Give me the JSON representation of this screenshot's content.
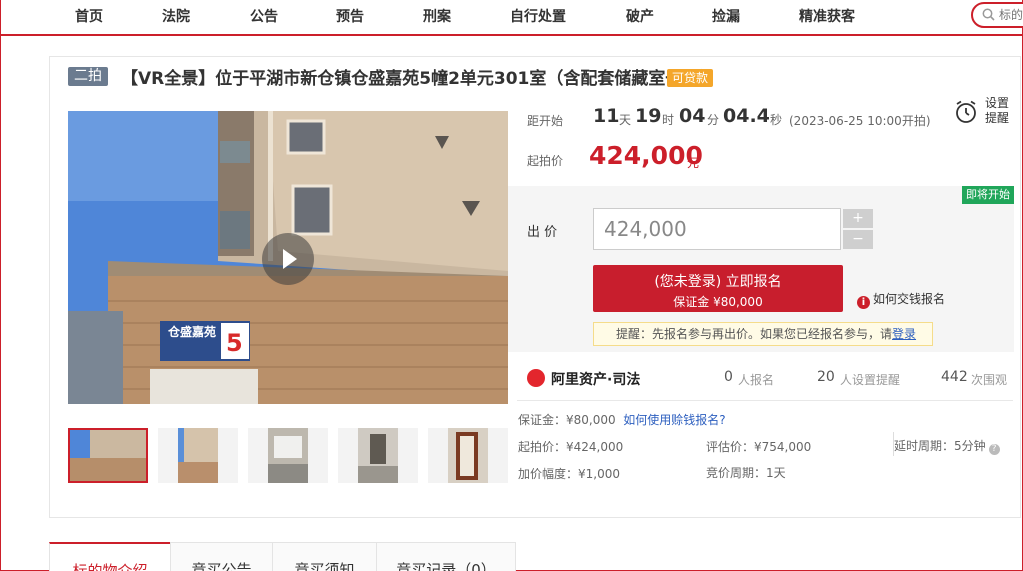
{
  "nav": {
    "items": [
      "首页",
      "法院",
      "公告",
      "预告",
      "刑案",
      "自行处置",
      "破产",
      "捡漏",
      "精准获客"
    ],
    "search_placeholder": "标的"
  },
  "listing": {
    "round_badge": "二拍",
    "title": "【VR全景】位于平湖市新仓镇仓盛嘉苑5幢2单元301室（含配套储藏室一个）",
    "loan_badge": "可贷款",
    "countdown": {
      "label": "距开始",
      "days": "11",
      "days_unit": "天",
      "hours": "19",
      "hours_unit": "时",
      "minutes": "04",
      "minutes_unit": "分",
      "seconds": "04.4",
      "seconds_unit": "秒",
      "start_note": "(2023-06-25 10:00开拍)"
    },
    "reminder_label_1": "设置",
    "reminder_label_2": "提醒",
    "start_price_label": "起拍价",
    "start_price": "424,000",
    "price_unit": "元",
    "status_tag": "即将开始",
    "bid_label": "出 价",
    "bid_value": "424,000",
    "plus": "+",
    "minus": "−",
    "signup_line1": "(您未登录) 立即报名",
    "signup_line2": "保证金 ¥80,000",
    "how_pay": "如何交钱报名",
    "tip_text": "提醒：先报名参与再出价。如果您已经报名参与，请",
    "tip_link": "登录",
    "brand_name": "阿里资产·司法",
    "stats": [
      {
        "num": "0",
        "unit": "人报名"
      },
      {
        "num": "20",
        "unit": "人设置提醒"
      },
      {
        "num": "442",
        "unit": "次围观"
      }
    ],
    "deposit_label": "保证金：¥80,000",
    "deposit_link": "如何使用赊钱报名?",
    "details": {
      "start_price": "起拍价：¥424,000",
      "appraisal": "评估价：¥754,000",
      "delay": "延时周期：5分钟",
      "increment": "加价幅度：¥1,000",
      "period": "竞价周期：1天"
    }
  },
  "tabs": [
    "标的物介绍",
    "竞买公告",
    "竞买须知",
    "竞买记录（0）"
  ]
}
